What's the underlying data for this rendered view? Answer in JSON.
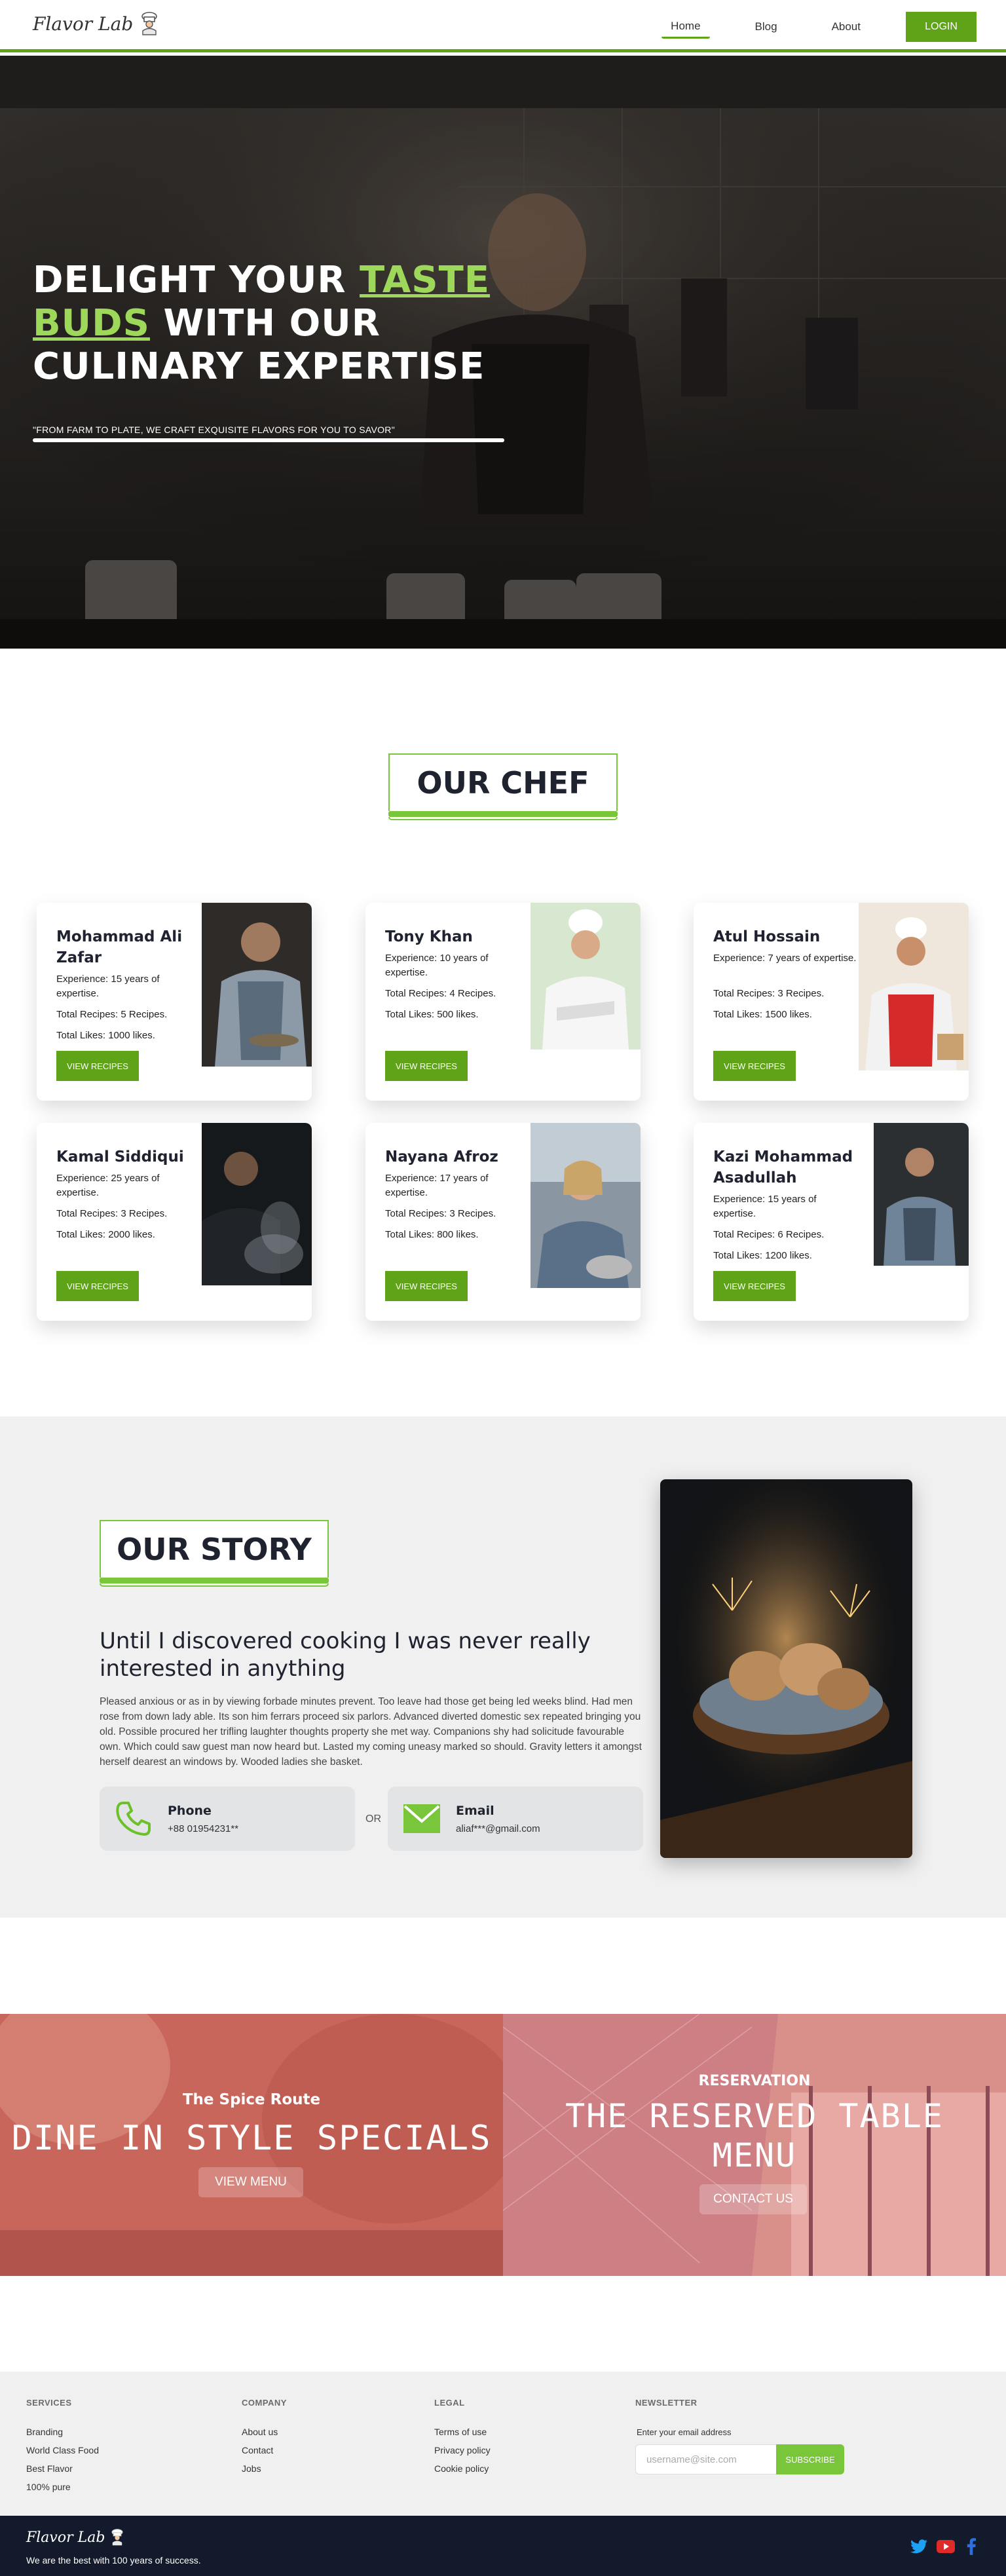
{
  "header": {
    "logo_text": "Flavor Lab",
    "nav": [
      {
        "label": "Home",
        "active": true
      },
      {
        "label": "Blog",
        "active": false
      },
      {
        "label": "About",
        "active": false
      }
    ],
    "login_label": "LOGIN"
  },
  "hero": {
    "title_part1": "DELIGHT YOUR ",
    "title_accent_1": "TASTE",
    "title_accent_2": "BUDS",
    "title_part2": " WITH OUR CULINARY EXPERTISE",
    "subtitle": "\"FROM FARM TO PLATE, WE CRAFT EXQUISITE FLAVORS FOR YOU TO SAVOR\""
  },
  "chef_section": {
    "heading": "OUR CHEF",
    "button_label": "VIEW RECIPES",
    "chefs": [
      {
        "name": "Mohammad Ali Zafar",
        "experience": "Experience: 15 years of expertise.",
        "recipes": "Total Recipes: 5 Recipes.",
        "likes": "Total Likes: 1000 likes."
      },
      {
        "name": "Tony Khan",
        "experience": "Experience: 10 years of expertise.",
        "recipes": "Total Recipes: 4 Recipes.",
        "likes": "Total Likes: 500 likes."
      },
      {
        "name": "Atul Hossain",
        "experience": "Experience: 7 years of expertise.",
        "recipes": "Total Recipes: 3 Recipes.",
        "likes": "Total Likes: 1500 likes."
      },
      {
        "name": "Kamal Siddiqui",
        "experience": "Experience: 25 years of expertise.",
        "recipes": "Total Recipes: 3 Recipes.",
        "likes": "Total Likes: 2000 likes."
      },
      {
        "name": "Nayana Afroz",
        "experience": "Experience: 17 years of expertise.",
        "recipes": "Total Recipes: 3 Recipes.",
        "likes": "Total Likes: 800 likes."
      },
      {
        "name": "Kazi Mohammad Asadullah",
        "experience": "Experience: 15 years of expertise.",
        "recipes": "Total Recipes: 6 Recipes.",
        "likes": "Total Likes: 1200 likes."
      }
    ]
  },
  "story": {
    "heading": "OUR STORY",
    "title": "Until I discovered cooking I was never really interested in anything",
    "body": "Pleased anxious or as in by viewing forbade minutes prevent. Too leave had those get being led weeks blind. Had men rose from down lady able. Its son him ferrars proceed six parlors. Advanced diverted domestic sex repeated bringing you old. Possible procured her trifling laughter thoughts property she met way. Companions shy had solicitude favourable own. Which could saw guest man now heard but. Lasted my coming uneasy marked so should. Gravity letters it amongst herself dearest an windows by. Wooded ladies she basket.",
    "phone_label": "Phone",
    "phone_value": "+88 01954231**",
    "or_label": "OR",
    "email_label": "Email",
    "email_value": "aliaf***@gmail.com"
  },
  "promos": {
    "left": {
      "eyebrow": "The Spice Route",
      "title": "DINE IN STYLE SPECIALS",
      "button": "VIEW MENU"
    },
    "right": {
      "eyebrow": "RESERVATION",
      "title_line1": "THE RESERVED TABLE",
      "title_line2": "MENU",
      "button": "CONTACT US"
    }
  },
  "footer": {
    "services_head": "SERVICES",
    "services": [
      "Branding",
      "World Class Food",
      "Best Flavor",
      "100% pure"
    ],
    "company_head": "COMPANY",
    "company": [
      "About us",
      "Contact",
      "Jobs"
    ],
    "legal_head": "LEGAL",
    "legal": [
      "Terms of use",
      "Privacy policy",
      "Cookie policy"
    ],
    "newsletter_head": "NEWSLETTER",
    "newsletter_label": "Enter your email address",
    "email_placeholder": "username@site.com",
    "subscribe_label": "SUBSCRIBE",
    "bottom_logo": "Flavor Lab",
    "tagline": "We are the best with 100 years of success.",
    "social_icons": [
      "twitter-icon",
      "youtube-icon",
      "facebook-icon"
    ]
  },
  "colors": {
    "accent": "#5fa318",
    "accent_light": "#7ac63a",
    "hero_accent": "#9ed85a",
    "footer_dark": "#131a2b"
  }
}
